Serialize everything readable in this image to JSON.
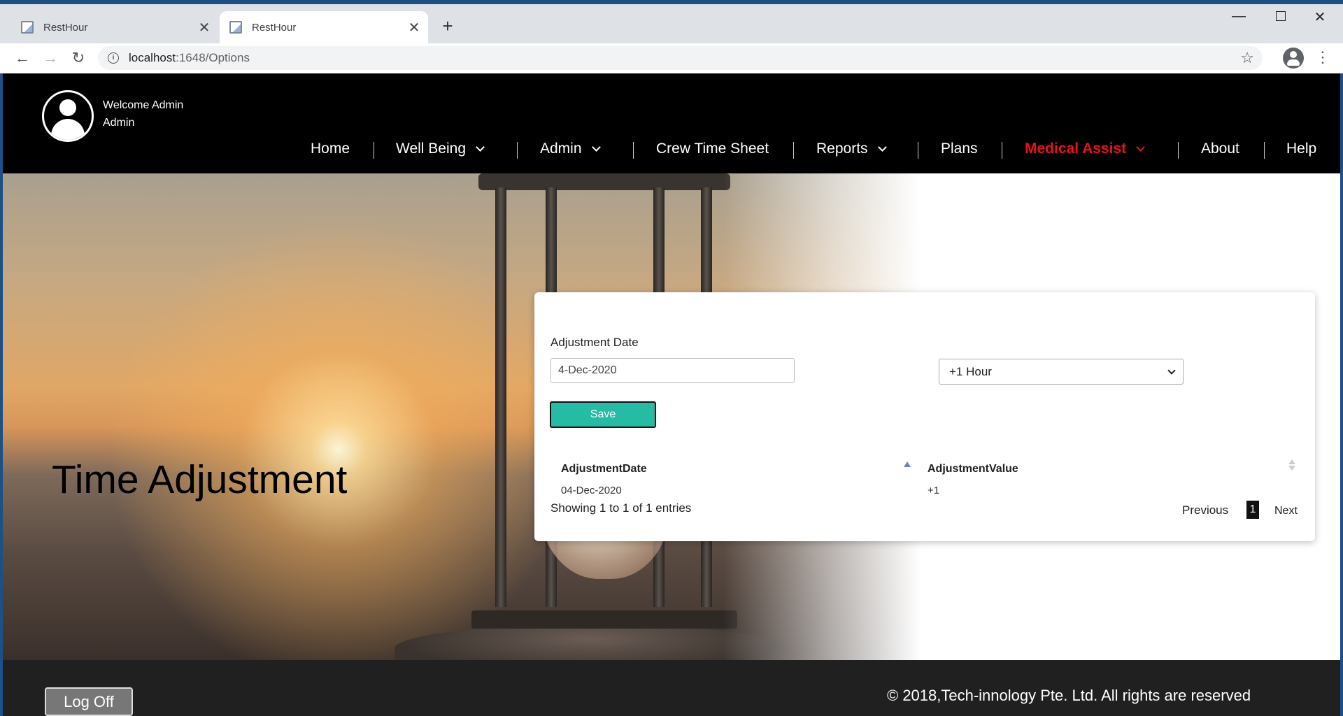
{
  "browser": {
    "tabs": [
      {
        "title": "RestHour",
        "active": false
      },
      {
        "title": "RestHour",
        "active": true
      }
    ],
    "url_host": "localhost",
    "url_path": ":1648/Options"
  },
  "header": {
    "welcome_line1": "Welcome Admin",
    "welcome_line2": "Admin",
    "nav": [
      {
        "label": "Home",
        "dropdown": false
      },
      {
        "label": "Well Being",
        "dropdown": true
      },
      {
        "label": "Admin",
        "dropdown": true
      },
      {
        "label": "Crew Time Sheet",
        "dropdown": false
      },
      {
        "label": "Reports",
        "dropdown": true
      },
      {
        "label": "Plans",
        "dropdown": false
      },
      {
        "label": "Medical Assist",
        "dropdown": true,
        "active": true
      },
      {
        "label": "About",
        "dropdown": false
      },
      {
        "label": "Help",
        "dropdown": false
      }
    ]
  },
  "hero": {
    "title": "Time Adjustment"
  },
  "form": {
    "date_label": "Adjustment Date",
    "date_value": "4-Dec-2020",
    "adjust_selected": "+1 Hour",
    "save_label": "Save"
  },
  "table": {
    "columns": [
      "AdjustmentDate",
      "AdjustmentValue"
    ],
    "rows": [
      [
        "04-Dec-2020",
        "+1"
      ]
    ],
    "info": "Showing 1 to 1 of 1 entries",
    "pagination": {
      "previous": "Previous",
      "current": "1",
      "next": "Next"
    }
  },
  "footer": {
    "logoff_label": "Log Off",
    "copyright": "© 2018,Tech-innology Pte. Ltd. All rights are reserved"
  },
  "colors": {
    "header_bg": "#000000",
    "nav_active": "#e8121d",
    "save_button": "#26bba4",
    "footer_bg": "#202020"
  }
}
